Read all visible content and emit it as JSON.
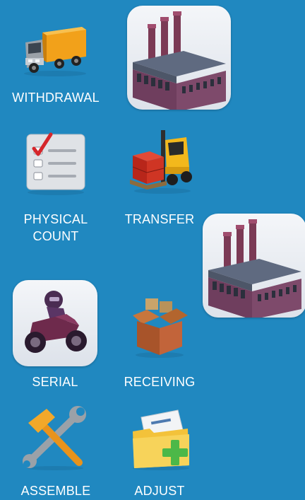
{
  "menu": {
    "withdrawal": {
      "label": "WITHDRAWAL",
      "icon": "truck-icon"
    },
    "physical_count": {
      "label_line1": "PHYSICAL",
      "label_line2": "COUNT",
      "icon": "checklist-icon"
    },
    "transfer": {
      "label": "TRANSFER",
      "icon": "forklift-icon"
    },
    "serial": {
      "label": "SERIAL",
      "icon": "motorcycle-icon"
    },
    "receiving": {
      "label": "RECEIVING",
      "icon": "open-box-icon"
    },
    "assemble": {
      "label": "ASSEMBLE",
      "icon": "tools-icon"
    },
    "adjust": {
      "label": "ADJUST",
      "icon": "folder-add-icon"
    }
  },
  "factory_tiles": [
    {
      "icon": "factory-icon"
    },
    {
      "icon": "factory-icon"
    }
  ],
  "colors": {
    "background": "#2088c0",
    "label": "#ffffff",
    "truck_cargo": "#f4a418",
    "factory_brick": "#7a3f5a",
    "check_red": "#d8282a",
    "plus_green": "#4cb848"
  }
}
